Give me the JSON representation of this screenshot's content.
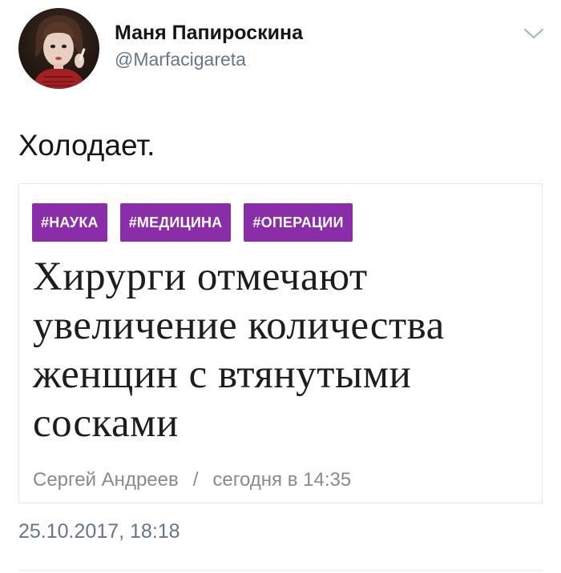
{
  "user": {
    "display_name": "Маня Папироскина",
    "handle": "@Marfacigareta",
    "avatar_icon": "profile-photo",
    "menu_icon": "chevron-down-icon"
  },
  "tweet": {
    "text": "Холодает.",
    "timestamp": "25.10.2017, 18:18"
  },
  "card": {
    "tags": [
      "#НАУКА",
      "#МЕДИЦИНА",
      "#ОПЕРАЦИИ"
    ],
    "headline": "Хирурги отмечают увеличение количества женщин с втянутыми сосками",
    "author": "Сергей Андреев",
    "separator": "/",
    "published": "сегодня в 14:35"
  },
  "colors": {
    "tag_background": "#8a2da8",
    "handle_gray": "#657786",
    "meta_gray": "#8a8a8a"
  }
}
